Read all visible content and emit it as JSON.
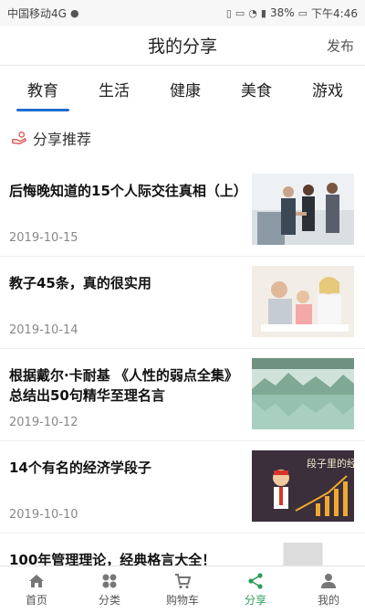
{
  "status_bar": {
    "carrier": "中国移动4G",
    "battery": "38%",
    "time": "下午4:46"
  },
  "header": {
    "title": "我的分享",
    "publish_label": "发布"
  },
  "tabs": [
    {
      "label": "教育",
      "active": true
    },
    {
      "label": "生活",
      "active": false
    },
    {
      "label": "健康",
      "active": false
    },
    {
      "label": "美食",
      "active": false
    },
    {
      "label": "游戏",
      "active": false
    }
  ],
  "section": {
    "title": "分享推荐"
  },
  "items": [
    {
      "title": "后悔晚知道的15个人际交往真相（上）",
      "date": "2019-10-15",
      "thumb": "business-meeting"
    },
    {
      "title": "教子45条，真的很实用",
      "date": "2019-10-14",
      "thumb": "family-drawing"
    },
    {
      "title": "根据戴尔·卡耐基 《人性的弱点全集》总结出50句精华至理名言",
      "date": "2019-10-12",
      "thumb": "lake-landscape"
    },
    {
      "title": "14个有名的经济学段子",
      "date": "2019-10-10",
      "thumb": "economics-cartoon"
    }
  ],
  "partial_item": {
    "title": "100年管理理论，经典格言大全！"
  },
  "thumb_labels": {
    "economics_caption": "段子里的经济学"
  },
  "bottom_nav": [
    {
      "label": "首页",
      "icon": "home-icon",
      "active": false
    },
    {
      "label": "分类",
      "icon": "grid-icon",
      "active": false
    },
    {
      "label": "购物车",
      "icon": "cart-icon",
      "active": false
    },
    {
      "label": "分享",
      "icon": "share-icon",
      "active": true
    },
    {
      "label": "我的",
      "icon": "user-icon",
      "active": false
    }
  ],
  "colors": {
    "accent_blue": "#1e6fd0",
    "active_green": "#2e9c5a"
  }
}
